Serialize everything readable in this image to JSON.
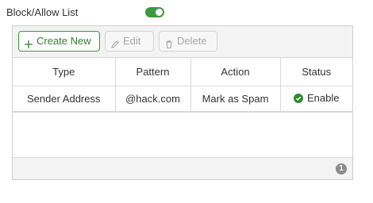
{
  "section": {
    "title": "Block/Allow List",
    "toggle_on": true,
    "accent_color": "#3c9a3c"
  },
  "toolbar": {
    "create_label": "Create New",
    "create_icon": "plus-icon",
    "edit_label": "Edit",
    "edit_icon": "pencil-icon",
    "delete_label": "Delete",
    "delete_icon": "trash-icon"
  },
  "table": {
    "columns": [
      "Type",
      "Pattern",
      "Action",
      "Status"
    ],
    "rows": [
      {
        "type": "Sender Address",
        "pattern": "@hack.com",
        "action": "Mark as Spam",
        "status": "Enable",
        "status_icon": "check-circle-icon",
        "status_color": "#2e8b2e"
      }
    ]
  },
  "pagination": {
    "page": "1"
  }
}
